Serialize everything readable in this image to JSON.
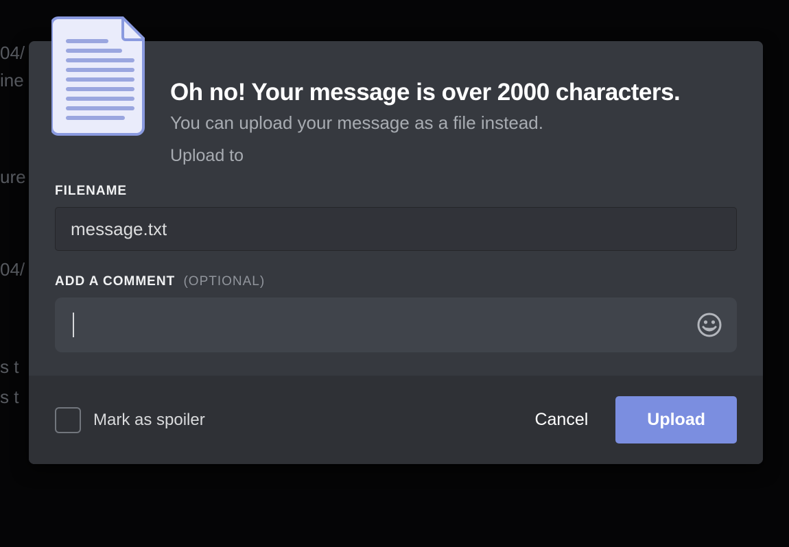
{
  "background": {
    "frag1": "04/",
    "frag2": "ine",
    "frag3": "ure",
    "frag4": "04/",
    "frag5": "s t",
    "frag6": "s t"
  },
  "modal": {
    "title": "Oh no! Your message is over 2000 characters.",
    "subtitle": "You can upload your message as a file instead.",
    "upload_to": "Upload to",
    "filename_label": "FILENAME",
    "filename_value": "message.txt",
    "comment_label": "ADD A COMMENT",
    "comment_optional": "(OPTIONAL)",
    "comment_value": "",
    "icons": {
      "file": "document-file-icon",
      "emoji": "emoji-picker-icon"
    }
  },
  "footer": {
    "spoiler_label": "Mark as spoiler",
    "spoiler_checked": false,
    "cancel": "Cancel",
    "upload": "Upload"
  }
}
